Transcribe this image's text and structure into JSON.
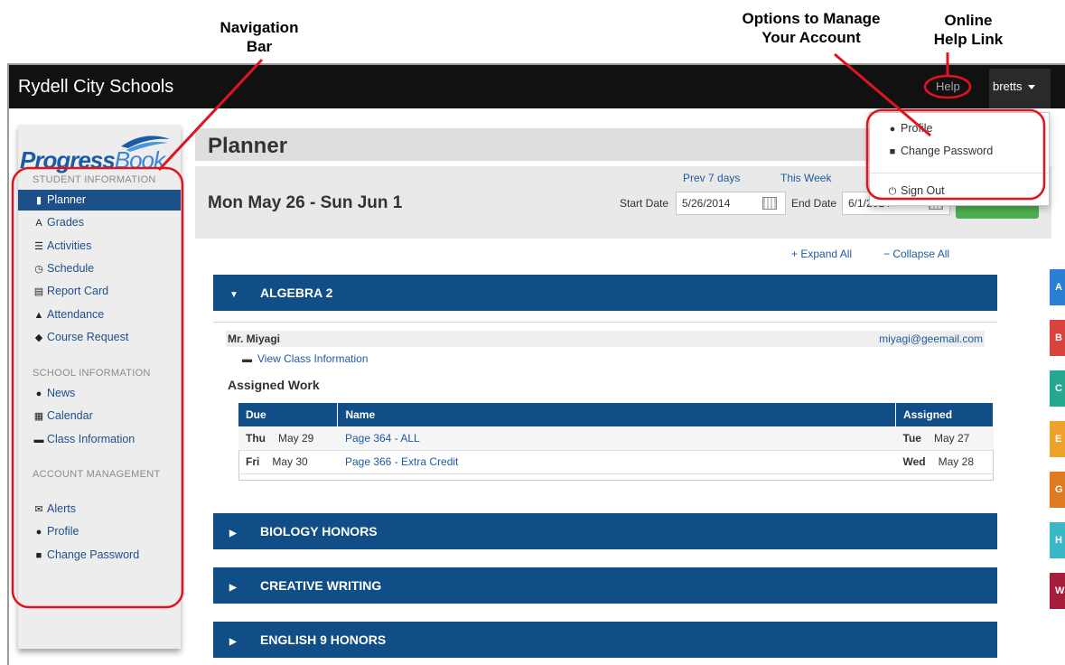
{
  "annotations": {
    "nav_bar": "Navigation\nBar",
    "manage_account": "Options to Manage\nYour Account",
    "help_link": "Online\nHelp Link"
  },
  "topbar": {
    "brand": "Rydell City Schools",
    "help": "Help",
    "user": "bretts"
  },
  "logo": {
    "text_a": "Progress",
    "text_b": "Book"
  },
  "sidebar": {
    "student_header": "STUDENT INFORMATION",
    "student_items": [
      {
        "label": "Planner",
        "icon": "planner-icon",
        "glyph": "▮"
      },
      {
        "label": "Grades",
        "icon": "grades-icon",
        "glyph": "A"
      },
      {
        "label": "Activities",
        "icon": "activities-icon",
        "glyph": "☰"
      },
      {
        "label": "Schedule",
        "icon": "clock-icon",
        "glyph": "◷"
      },
      {
        "label": "Report Card",
        "icon": "report-card-icon",
        "glyph": "▤"
      },
      {
        "label": "Attendance",
        "icon": "bell-icon",
        "glyph": "▲"
      },
      {
        "label": "Course Request",
        "icon": "tag-icon",
        "glyph": "◆"
      }
    ],
    "school_header": "SCHOOL INFORMATION",
    "school_items": [
      {
        "label": "News",
        "icon": "globe-icon",
        "glyph": "●"
      },
      {
        "label": "Calendar",
        "icon": "calendar-icon",
        "glyph": "▦"
      },
      {
        "label": "Class Information",
        "icon": "comment-icon",
        "glyph": "▬"
      }
    ],
    "account_header": "ACCOUNT MANAGEMENT",
    "account_items": [
      {
        "label": "Alerts",
        "icon": "envelope-icon",
        "glyph": "✉"
      },
      {
        "label": "Profile",
        "icon": "info-icon",
        "glyph": "●"
      },
      {
        "label": "Change Password",
        "icon": "lock-icon",
        "glyph": "■"
      }
    ]
  },
  "main": {
    "title": "Planner",
    "date_range": "Mon May 26 - Sun Jun 1",
    "prev_link": "Prev 7 days",
    "this_week_link": "This Week",
    "start_label": "Start Date",
    "start_value": "5/26/2014",
    "end_label": "End Date",
    "end_value": "6/1/2014",
    "expand_all": "+ Expand All",
    "collapse_all": "− Collapse All"
  },
  "dropdown": {
    "profile": "Profile",
    "change_password": "Change Password",
    "sign_out": "Sign Out"
  },
  "classes": [
    {
      "name": "ALGEBRA 2",
      "expanded": true
    },
    {
      "name": "BIOLOGY HONORS",
      "expanded": false
    },
    {
      "name": "CREATIVE WRITING",
      "expanded": false
    },
    {
      "name": "ENGLISH 9 HONORS",
      "expanded": false
    }
  ],
  "algebra": {
    "teacher": "Mr. Miyagi",
    "email": "miyagi@geemail.com",
    "view_class": "View Class Information",
    "assigned_title": "Assigned Work",
    "columns": {
      "due": "Due",
      "name": "Name",
      "assigned": "Assigned"
    },
    "rows": [
      {
        "due_day": "Thu",
        "due_date": "May 29",
        "name": "Page 364 - ALL",
        "assigned_day": "Tue",
        "assigned_date": "May 27"
      },
      {
        "due_day": "Fri",
        "due_date": "May 30",
        "name": "Page 366 - Extra Credit",
        "assigned_day": "Wed",
        "assigned_date": "May 28"
      }
    ]
  },
  "side_tabs": [
    {
      "letter": "A",
      "color": "#2a7fd4"
    },
    {
      "letter": "B",
      "color": "#d9433b"
    },
    {
      "letter": "C",
      "color": "#26a88f"
    },
    {
      "letter": "E",
      "color": "#eea22a"
    },
    {
      "letter": "G",
      "color": "#e07a22"
    },
    {
      "letter": "H",
      "color": "#3bb8c6"
    },
    {
      "letter": "W",
      "color": "#a51d3a"
    }
  ],
  "colors": {
    "nav_blue": "#114d87",
    "annotation_red": "#e0141e",
    "topbar": "#111111"
  }
}
